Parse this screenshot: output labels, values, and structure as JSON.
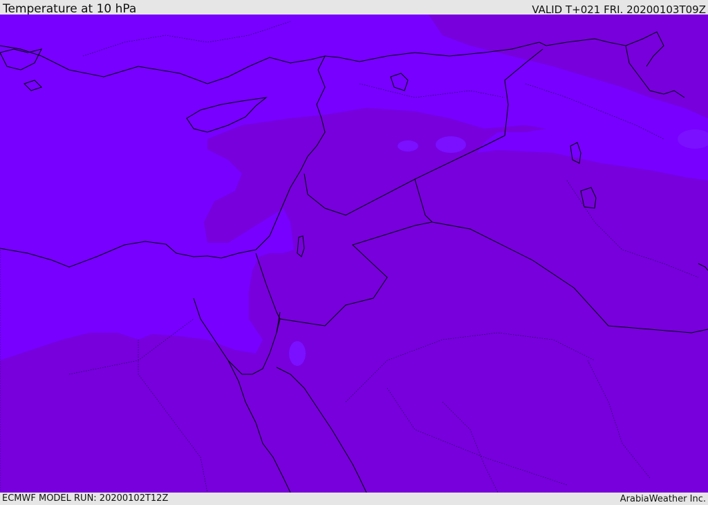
{
  "header": {
    "title": "Temperature at 10 hPa",
    "valid_time": "VALID T+021 FRI. 20200103T09Z"
  },
  "footer": {
    "model_run": "ECMWF MODEL RUN: 20200102T12Z",
    "credit": "ArabiaWeather Inc."
  },
  "map": {
    "colors": {
      "band_light": "#7700ff",
      "band_dark": "#7700dd",
      "coastline": "#000000",
      "border": "#000000"
    }
  }
}
